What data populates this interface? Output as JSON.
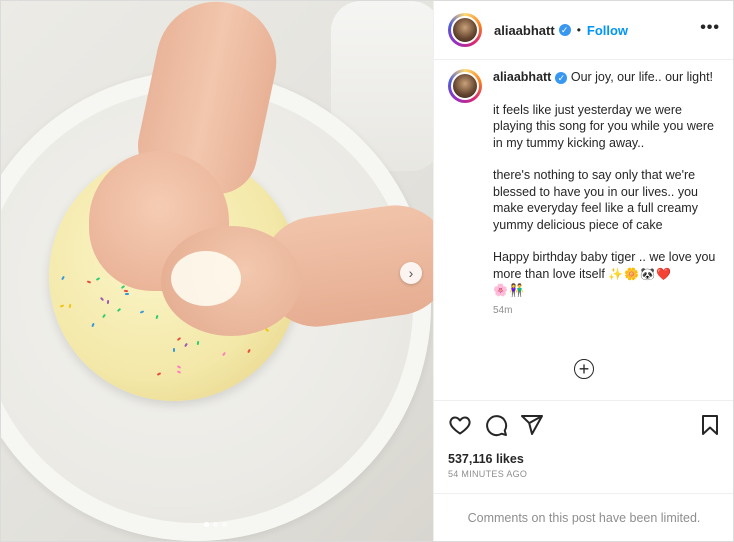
{
  "post": {
    "username": "aliaabhatt",
    "verified_icon": "verified-badge-icon",
    "separator": "•",
    "follow_label": "Follow",
    "more_icon": "more-options-icon",
    "more_glyph": "•••",
    "next_glyph": "›",
    "carousel": {
      "count": 3,
      "active_index": 0
    }
  },
  "caption": {
    "username": "aliaabhatt",
    "line1": "Our joy, our life.. our light!",
    "para2": "it feels like just yesterday we were playing this song for you while you were in my tummy kicking away..",
    "para3": "there's nothing to say only that we're blessed to have you in our lives.. you make everyday feel like a full creamy yummy delicious piece of cake",
    "para4": "Happy birthday baby tiger .. we love you more than love itself",
    "emojis_line1": "✨🌼🐼❤️",
    "emojis_line2": "🌸👫",
    "time": "54m"
  },
  "actions": {
    "like_icon": "heart-icon",
    "comment_icon": "comment-icon",
    "share_icon": "share-icon",
    "save_icon": "bookmark-icon",
    "add_glyph": "+",
    "likes": "537,116 likes",
    "ago": "54 MINUTES AGO"
  },
  "comments_note": "Comments on this post have been limited."
}
